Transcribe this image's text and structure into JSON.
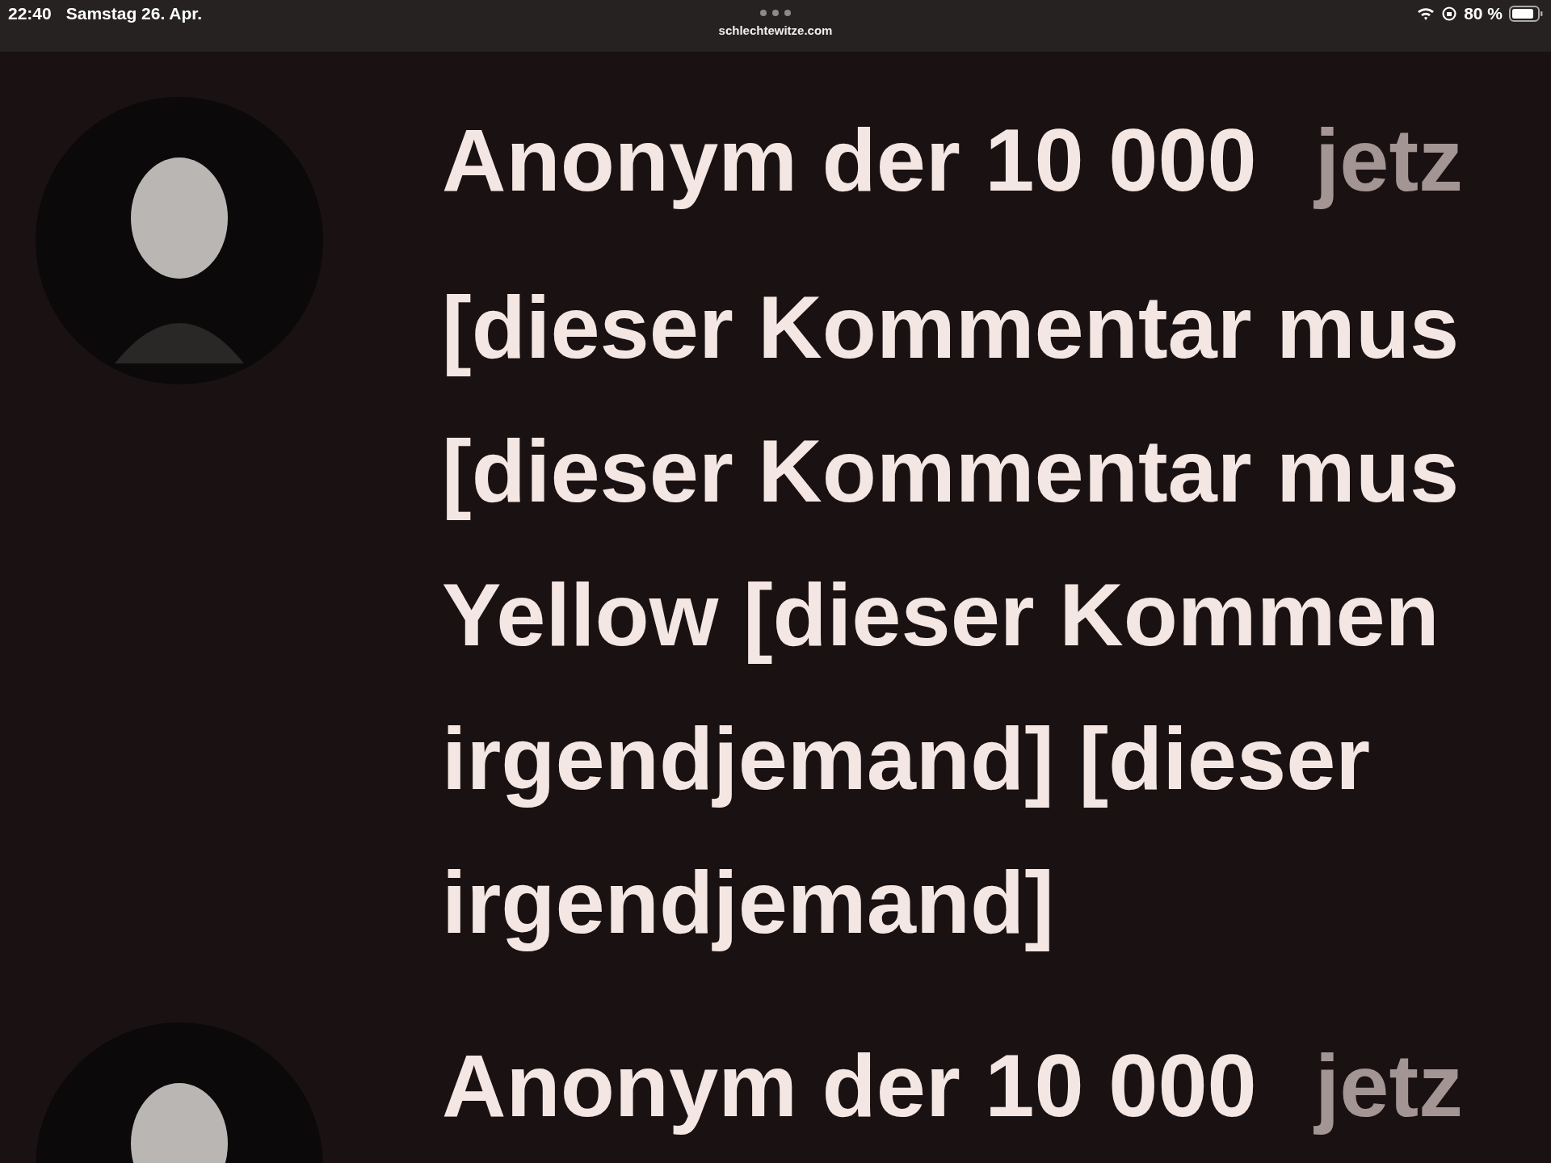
{
  "status_bar": {
    "time": "22:40",
    "date": "Samstag 26. Apr.",
    "url": "schlechtewitze.com",
    "battery": "80 %"
  },
  "comments": [
    {
      "author": "Anonym der 10 000",
      "time": "jetz",
      "lines": [
        "[dieser Kommentar mus",
        "[dieser Kommentar mus",
        "Yellow [dieser Kommen",
        "irgendjemand] [dieser",
        "irgendjemand]"
      ]
    },
    {
      "author": "Anonym der 10 000",
      "time": "jetz"
    }
  ]
}
